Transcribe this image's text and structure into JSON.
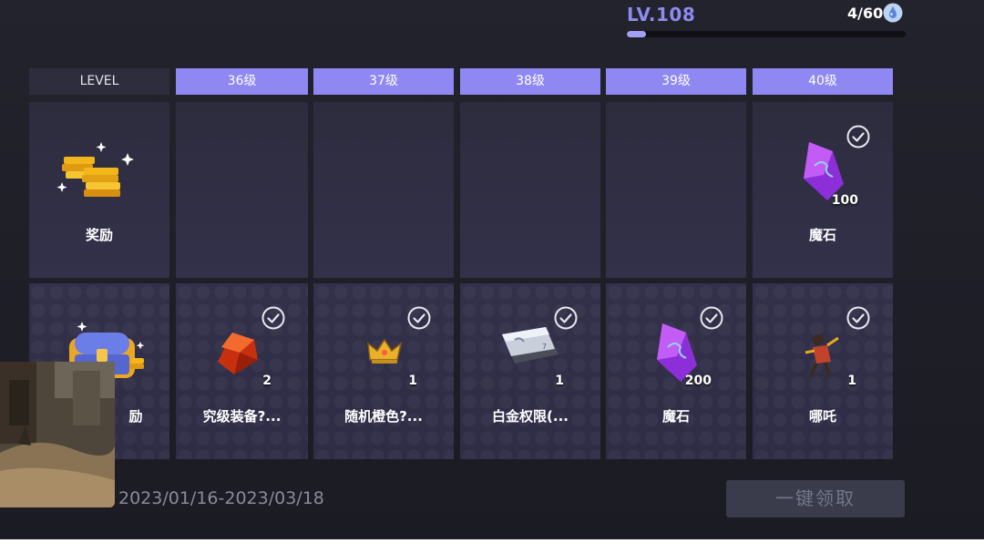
{
  "header": {
    "level_label": "LV.108",
    "progress_text": "4/60",
    "progress_fraction": 0.067,
    "currency_icon": "water-drop-icon"
  },
  "columns": [
    {
      "label": "LEVEL"
    },
    {
      "label": "36级"
    },
    {
      "label": "37级"
    },
    {
      "label": "38级"
    },
    {
      "label": "39级"
    },
    {
      "label": "40级"
    }
  ],
  "rows": {
    "free": {
      "label": "奖励",
      "icon": "gold-coins-icon",
      "rewards": [
        {
          "name": "",
          "qty": "",
          "icon": "",
          "claimed": false
        },
        {
          "name": "",
          "qty": "",
          "icon": "",
          "claimed": false
        },
        {
          "name": "",
          "qty": "",
          "icon": "",
          "claimed": false
        },
        {
          "name": "",
          "qty": "",
          "icon": "",
          "claimed": false
        },
        {
          "name": "魔石",
          "qty": "100",
          "icon": "purple-crystal-icon",
          "claimed": true
        }
      ]
    },
    "premium": {
      "label": "励",
      "icon": "treasure-chest-icon",
      "rewards": [
        {
          "name": "究级装备?...",
          "qty": "2",
          "icon": "red-gem-icon",
          "claimed": true
        },
        {
          "name": "随机橙色?...",
          "qty": "1",
          "icon": "gold-crown-icon",
          "claimed": true
        },
        {
          "name": "白金权限(...",
          "qty": "1",
          "icon": "platinum-card-icon",
          "claimed": true
        },
        {
          "name": "魔石",
          "qty": "200",
          "icon": "purple-crystal-icon",
          "claimed": true
        },
        {
          "name": "哪吒",
          "qty": "1",
          "icon": "character-figure-icon",
          "claimed": true
        }
      ]
    }
  },
  "footer": {
    "date_range": "2023/01/16-2023/03/18",
    "claim_all_label": "一键领取"
  },
  "colors": {
    "accent": "#8f88f2",
    "level_text": "#8e8af0",
    "cell_bg": "#2d2c3e",
    "claim_disabled": "#3a3c4c"
  }
}
